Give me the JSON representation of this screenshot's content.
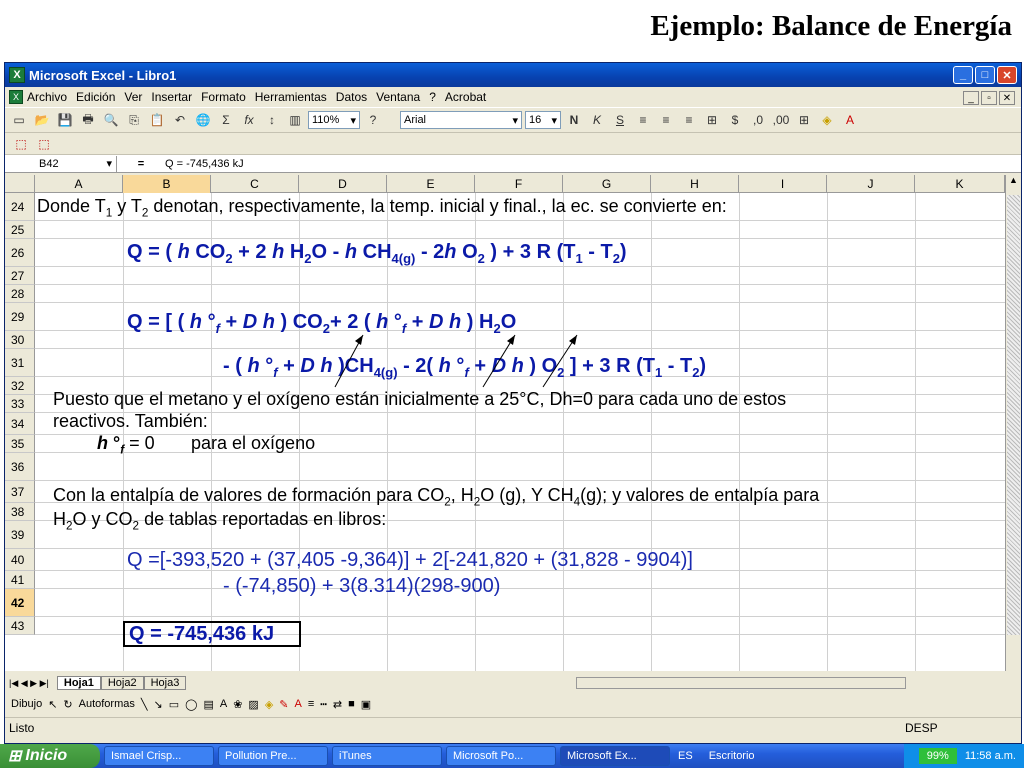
{
  "slide_title": "Ejemplo: Balance de Energía",
  "window": {
    "title": "Microsoft Excel - Libro1"
  },
  "menu": [
    "Archivo",
    "Edición",
    "Ver",
    "Insertar",
    "Formato",
    "Herramientas",
    "Datos",
    "Ventana",
    "?",
    "Acrobat"
  ],
  "toolbar": {
    "zoom": "110%",
    "font": "Arial",
    "size": "16"
  },
  "formula_bar": {
    "cell": "B42",
    "formula": "Q = -745,436 kJ"
  },
  "columns": [
    "A",
    "B",
    "C",
    "D",
    "E",
    "F",
    "G",
    "H",
    "I",
    "J",
    "K"
  ],
  "rows": [
    "24",
    "25",
    "26",
    "27",
    "28",
    "29",
    "30",
    "31",
    "32",
    "33",
    "34",
    "35",
    "36",
    "37",
    "38",
    "39",
    "40",
    "41",
    "42",
    "43"
  ],
  "content": {
    "line24": "Donde T",
    "line24b": " y T",
    "line24c": " denotan, respectivamente, la temp. inicial y final., la ec. se convierte en:",
    "line32": "Puesto que el metano y el oxígeno están inicialmente a 25°C, Dh=0 para cada uno de estos",
    "line33": "reactivos. También:",
    "line34": "para el oxígeno",
    "line36": "Con la entalpía de valores de formación para CO",
    "line37": "de tablas reportadas en libros:",
    "line39": "Q =[-393,520 + (37,405 -9,364)] + 2[-241,820 + (31,828 - 9904)]",
    "line40": "- (-74,850) + 3(8.314)(298-900)",
    "line42": "Q = -745,436 kJ"
  },
  "sheets": [
    "Hoja1",
    "Hoja2",
    "Hoja3"
  ],
  "drawing": {
    "draw": "Dibujo",
    "autoshapes": "Autoformas"
  },
  "status": {
    "left": "Listo",
    "right": "DESP"
  },
  "taskbar": {
    "start": "Inicio",
    "tasks": [
      "Ismael Crisp...",
      "Pollution Pre...",
      "iTunes",
      "Microsoft Po...",
      "Microsoft Ex..."
    ],
    "lang": "ES",
    "desktop": "Escritorio",
    "battery": "99%",
    "clock": "11:58 a.m."
  }
}
